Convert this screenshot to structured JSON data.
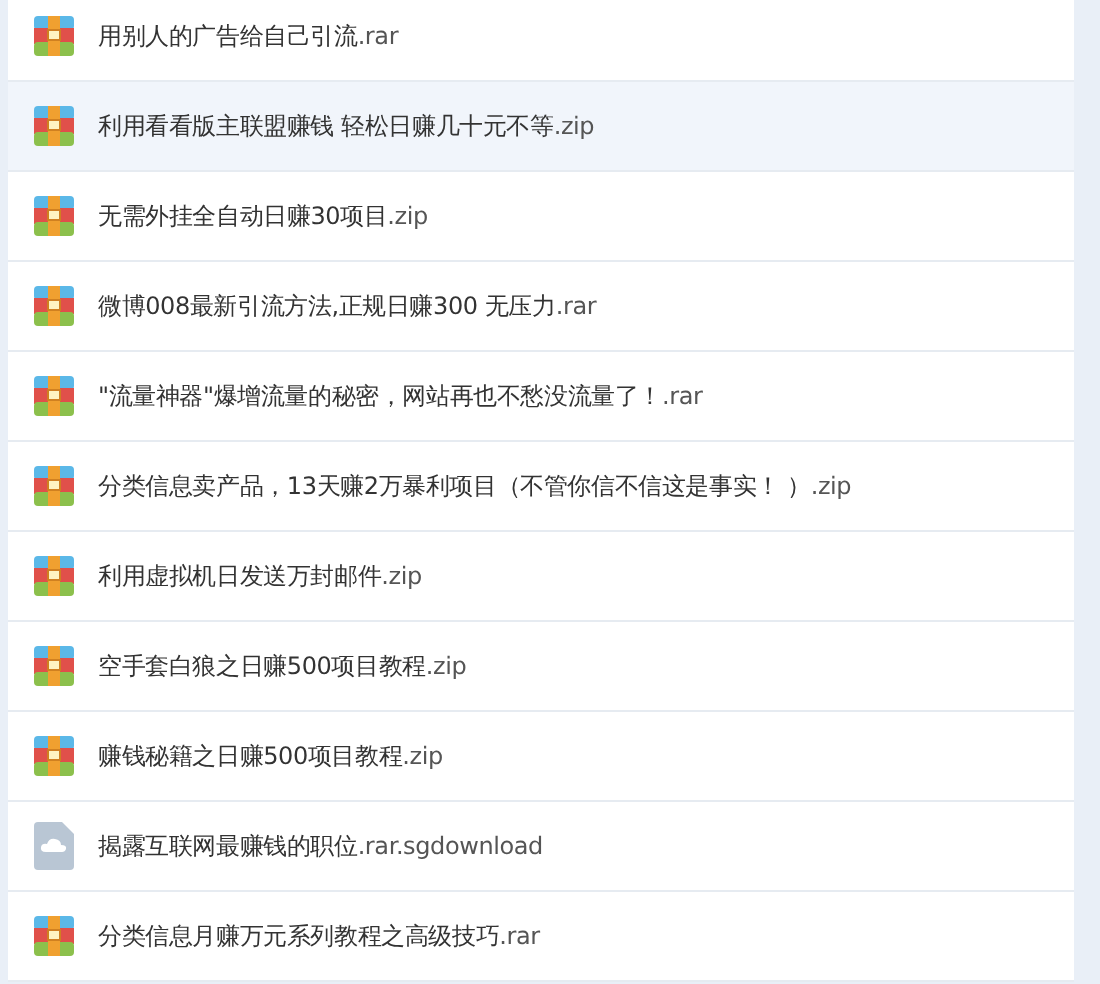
{
  "files": [
    {
      "name": "用别人的广告给自己引流",
      "ext": ".rar",
      "kind": "archive",
      "selected": false
    },
    {
      "name": "利用看看版主联盟赚钱 轻松日赚几十元不等",
      "ext": ".zip",
      "kind": "archive",
      "selected": true
    },
    {
      "name": "无需外挂全自动日赚30项目",
      "ext": ".zip",
      "kind": "archive",
      "selected": false
    },
    {
      "name": "微博008最新引流方法,正规日赚300 无压力",
      "ext": ".rar",
      "kind": "archive",
      "selected": false
    },
    {
      "name": "\"流量神器\"爆增流量的秘密，网站再也不愁没流量了！",
      "ext": ".rar",
      "kind": "archive",
      "selected": false
    },
    {
      "name": "分类信息卖产品，13天赚2万暴利项目（不管你信不信这是事实！ ）",
      "ext": ".zip",
      "kind": "archive",
      "selected": false
    },
    {
      "name": "利用虚拟机日发送万封邮件",
      "ext": ".zip",
      "kind": "archive",
      "selected": false
    },
    {
      "name": "空手套白狼之日赚500项目教程",
      "ext": ".zip",
      "kind": "archive",
      "selected": false
    },
    {
      "name": "赚钱秘籍之日赚500项目教程",
      "ext": ".zip",
      "kind": "archive",
      "selected": false
    },
    {
      "name": "揭露互联网最赚钱的职位",
      "ext": ".rar.sgdownload",
      "kind": "download",
      "selected": false
    },
    {
      "name": "分类信息月赚万元系列教程之高级技巧",
      "ext": ".rar",
      "kind": "archive",
      "selected": false
    }
  ]
}
